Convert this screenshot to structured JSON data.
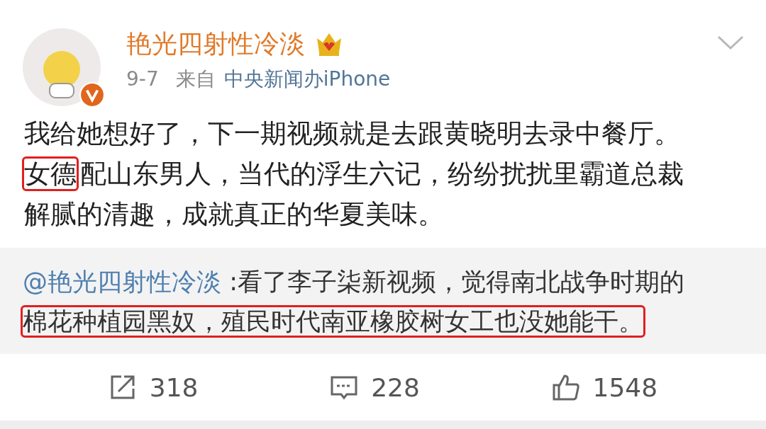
{
  "post": {
    "author": "艳光四射性冷淡",
    "verified": true,
    "date": "9-7",
    "source_prefix": "来自",
    "source": "中央新闻办iPhone",
    "lines": [
      [
        {
          "text": "我给她想好了，下一期视频就是去跟黄晓明去录中餐厅。",
          "highlighted": false
        }
      ],
      [
        {
          "text": "女德",
          "highlighted": true
        },
        {
          "text": "配山东男人，当代的浮生六记，纷纷扰扰里霸道总裁",
          "highlighted": false
        }
      ],
      [
        {
          "text": "解腻的清趣，成就真正的华夏美味。",
          "highlighted": false
        }
      ]
    ]
  },
  "repost": {
    "mention": "@艳光四射性冷淡",
    "lines": [
      [
        {
          "text": " :看了李子柒新视频，觉得南北战争时期的",
          "highlighted": false
        }
      ],
      [
        {
          "text": "棉花种植园黑奴，殖民时代南亚橡胶树女工也没她能干。",
          "highlighted": true
        }
      ]
    ]
  },
  "actions": [
    {
      "kind": "repost",
      "count": "318"
    },
    {
      "kind": "comment",
      "count": "228"
    },
    {
      "kind": "like",
      "count": "1548"
    }
  ]
}
